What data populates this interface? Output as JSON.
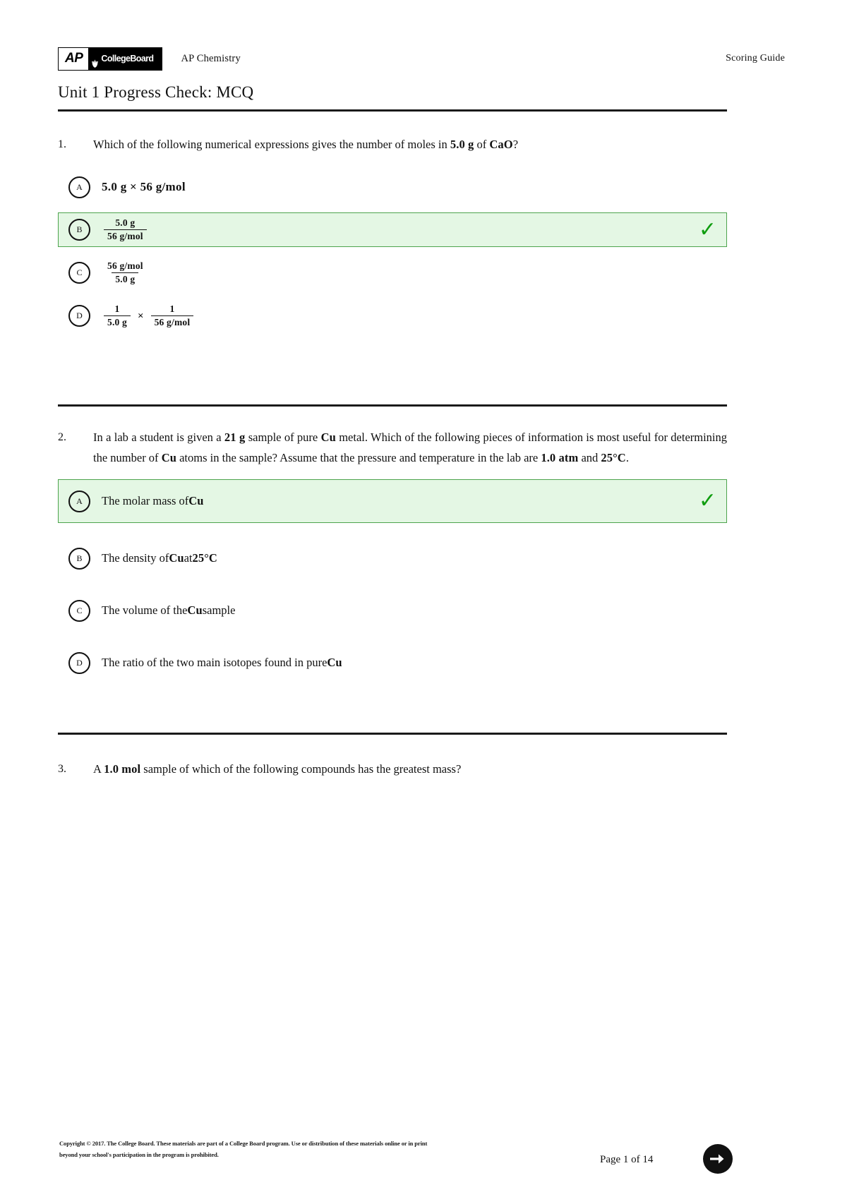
{
  "header": {
    "logo_ap": "AP",
    "logo_collegeboard": "CollegeBoard",
    "subject": "AP Chemistry",
    "doc_type": "Scoring Guide"
  },
  "title": "Unit 1 Progress Check: MCQ",
  "colors": {
    "correct_bg": "#e4f7e4",
    "correct_border": "#4da44d",
    "check_green": "#0f9d0f",
    "rule": "#1a1a1a"
  },
  "questions": [
    {
      "number": "1.",
      "prompt_parts": {
        "p1": "Which of the following numerical expressions gives the number of moles in ",
        "b1": "5.0 g",
        "p2": " of ",
        "b2": "CaO",
        "p3": "?"
      },
      "options": [
        {
          "letter": "A",
          "type": "inline",
          "text": "5.0 g × 56 g/mol",
          "correct": false
        },
        {
          "letter": "B",
          "type": "fraction",
          "numerator": "5.0 g",
          "denominator": "56 g/mol",
          "correct": true
        },
        {
          "letter": "C",
          "type": "fraction",
          "numerator": "56 g/mol",
          "denominator": "5.0 g",
          "correct": false
        },
        {
          "letter": "D",
          "type": "fraction-product",
          "numerator1": "1",
          "denominator1": "5.0 g",
          "operator": "×",
          "numerator2": "1",
          "denominator2": "56 g/mol",
          "correct": false
        }
      ]
    },
    {
      "number": "2.",
      "prompt_parts": {
        "p1": "In a lab a student is given a ",
        "b1": "21 g",
        "p2": " sample of pure ",
        "b2": "Cu",
        "p3": " metal. Which of the following pieces of information is most useful for determining the number of ",
        "b3": "Cu",
        "p4": " atoms in the sample? Assume that the pressure and temperature in the lab are ",
        "b4": "1.0 atm",
        "p5": " and ",
        "b5": "25°C",
        "p6": "."
      },
      "options": [
        {
          "letter": "A",
          "type": "rich",
          "pre": "The molar mass of ",
          "bold": "Cu",
          "post": "",
          "correct": true
        },
        {
          "letter": "B",
          "type": "rich",
          "pre": "The density of ",
          "bold": "Cu",
          "post": " at ",
          "bold2": "25°C",
          "correct": false
        },
        {
          "letter": "C",
          "type": "rich",
          "pre": "The volume of the ",
          "bold": "Cu",
          "post": " sample",
          "correct": false
        },
        {
          "letter": "D",
          "type": "rich",
          "pre": "The ratio of the two main isotopes found in pure ",
          "bold": "Cu",
          "post": "",
          "correct": false
        }
      ]
    },
    {
      "number": "3.",
      "prompt_parts": {
        "p1": "A ",
        "b1": "1.0 mol",
        "p2": " sample of which of the following compounds has the greatest mass?"
      },
      "options": []
    }
  ],
  "footer": {
    "copyright_line1": "Copyright © 2017. The College Board. These materials are part of a College Board program. Use or distribution of these materials online or in print",
    "copyright_line2": "beyond your school's participation in the program is prohibited.",
    "page_label": "Page 1 of 14",
    "next_icon": "arrow-right-circle"
  }
}
